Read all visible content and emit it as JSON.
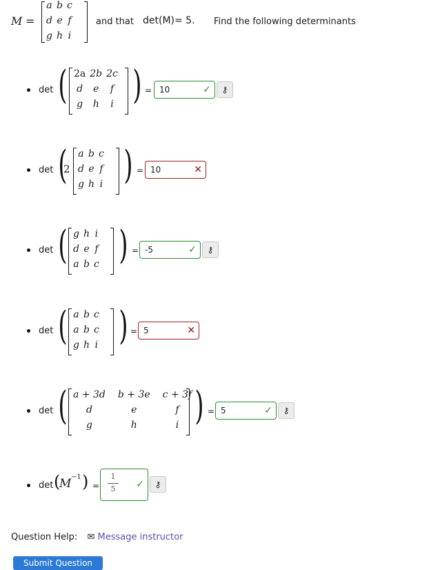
{
  "intro": {
    "matrix_name": "M",
    "equals": "=",
    "matrix": [
      [
        "a",
        "b",
        "c"
      ],
      [
        "d",
        "e",
        "f"
      ],
      [
        "g",
        "h",
        "i"
      ]
    ],
    "and_that": "and that",
    "det_statement": "det(M)= 5.",
    "instruction": "Find the following determinants"
  },
  "questions": [
    {
      "label": "det",
      "scalar": "",
      "matrix": [
        [
          "2a",
          "2b",
          "2c"
        ],
        [
          "d",
          "e",
          "f"
        ],
        [
          "g",
          "h",
          "i"
        ]
      ],
      "equals": "=",
      "answer": "10",
      "status": "correct",
      "status_icon": "✓",
      "key_icon": "⚷"
    },
    {
      "label": "det",
      "scalar": "2",
      "matrix": [
        [
          "a",
          "b",
          "c"
        ],
        [
          "d",
          "e",
          "f"
        ],
        [
          "g",
          "h",
          "i"
        ]
      ],
      "equals": "=",
      "answer": "10",
      "status": "incorrect",
      "status_icon": "✕",
      "key_icon": ""
    },
    {
      "label": "det",
      "scalar": "",
      "matrix": [
        [
          "g",
          "h",
          "i"
        ],
        [
          "d",
          "e",
          "f"
        ],
        [
          "a",
          "b",
          "c"
        ]
      ],
      "equals": "=",
      "answer": "-5",
      "status": "correct",
      "status_icon": "✓",
      "key_icon": "⚷"
    },
    {
      "label": "det",
      "scalar": "",
      "matrix": [
        [
          "a",
          "b",
          "c"
        ],
        [
          "a",
          "b",
          "c"
        ],
        [
          "g",
          "h",
          "i"
        ]
      ],
      "equals": "=",
      "answer": "5",
      "status": "incorrect",
      "status_icon": "✕",
      "key_icon": ""
    },
    {
      "label": "det",
      "scalar": "",
      "matrix": [
        [
          "a + 3d",
          "b + 3e",
          "c + 3f"
        ],
        [
          "d",
          "e",
          "f"
        ],
        [
          "g",
          "h",
          "i"
        ]
      ],
      "equals": "=",
      "answer": "5",
      "status": "correct",
      "status_icon": "✓",
      "key_icon": "⚷"
    },
    {
      "label": "det",
      "expression": "M",
      "exponent": "−1",
      "equals": "=",
      "answer_numerator": "1",
      "answer_denominator": "5",
      "status": "correct",
      "status_icon": "✓",
      "key_icon": "⚷"
    }
  ],
  "help": {
    "label": "Question Help:",
    "mail_icon": "✉",
    "link": "Message instructor"
  },
  "submit": {
    "label": "Submit Question"
  }
}
